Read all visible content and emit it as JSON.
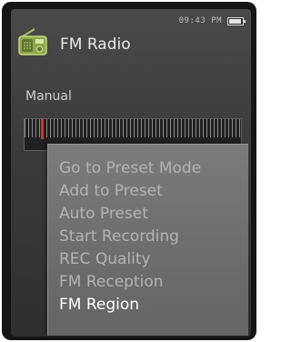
{
  "status": {
    "time": "09:43 PM",
    "battery_level": 0.9,
    "battery_icon": "battery-icon"
  },
  "header": {
    "icon": "radio-icon",
    "title": "FM Radio"
  },
  "tuner": {
    "mode": "Manual",
    "needle_color": "#d93030"
  },
  "menu": {
    "items": [
      {
        "label": "Go to Preset Mode"
      },
      {
        "label": "Add to Preset"
      },
      {
        "label": "Auto Preset"
      },
      {
        "label": "Start Recording"
      },
      {
        "label": "REC Quality"
      },
      {
        "label": "FM Reception"
      },
      {
        "label": "FM Region"
      }
    ],
    "selected_item": "FM Region"
  }
}
